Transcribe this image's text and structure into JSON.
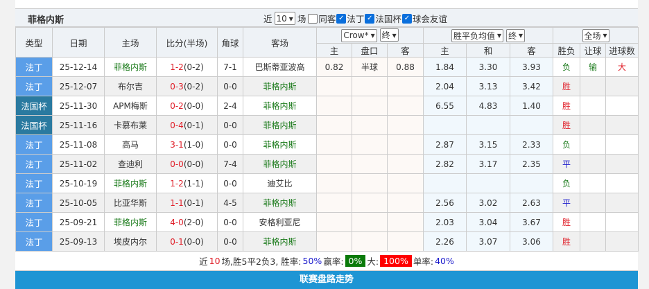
{
  "team": "菲格内斯",
  "filter": {
    "prefix": "近",
    "count": "10",
    "suffix": "场",
    "options": [
      {
        "label": "同客",
        "checked": false
      },
      {
        "label": "法丁",
        "checked": true
      },
      {
        "label": "法国杯",
        "checked": true
      },
      {
        "label": "球会友谊",
        "checked": true
      }
    ]
  },
  "headers": {
    "type": "类型",
    "date": "日期",
    "home": "主场",
    "score": "比分(半场)",
    "corner": "角球",
    "away": "客场",
    "company": "Crow*",
    "stage1": "终",
    "avg": "胜平负均值",
    "stage2": "终",
    "scope": "全场",
    "h_home": "主",
    "h_line": "盘口",
    "h_away": "客",
    "e_home": "主",
    "e_draw": "和",
    "e_away": "客",
    "res": "胜负",
    "ah": "让球",
    "ou": "进球数"
  },
  "rows": [
    {
      "type": "法丁",
      "cup": false,
      "date": "25-12-14",
      "home": "菲格内斯",
      "home_team": true,
      "ft": "1-2",
      "ht": "(0-2)",
      "corner": "7-1",
      "away": "巴斯蒂亚波高",
      "away_team": false,
      "ah_h": "0.82",
      "ah_l": "半球",
      "ah_a": "0.88",
      "e_h": "1.84",
      "e_d": "3.30",
      "e_a": "3.93",
      "res": "负",
      "ah": "输",
      "ou": "大"
    },
    {
      "type": "法丁",
      "cup": false,
      "date": "25-12-07",
      "home": "布尔吉",
      "home_team": false,
      "ft": "0-3",
      "ht": "(0-2)",
      "corner": "0-0",
      "away": "菲格内斯",
      "away_team": true,
      "e_h": "2.04",
      "e_d": "3.13",
      "e_a": "3.42",
      "res": "胜"
    },
    {
      "type": "法国杯",
      "cup": true,
      "date": "25-11-30",
      "home": "APM梅斯",
      "home_team": false,
      "ft": "0-2",
      "ht": "(0-0)",
      "corner": "2-4",
      "away": "菲格内斯",
      "away_team": true,
      "e_h": "6.55",
      "e_d": "4.83",
      "e_a": "1.40",
      "res": "胜"
    },
    {
      "type": "法国杯",
      "cup": true,
      "date": "25-11-16",
      "home": "卡慕布莱",
      "home_team": false,
      "ft": "0-4",
      "ht": "(0-1)",
      "corner": "0-0",
      "away": "菲格内斯",
      "away_team": true,
      "res": "胜"
    },
    {
      "type": "法丁",
      "cup": false,
      "date": "25-11-08",
      "home": "高马",
      "home_team": false,
      "ft": "3-1",
      "ht": "(1-0)",
      "corner": "0-0",
      "away": "菲格内斯",
      "away_team": true,
      "e_h": "2.87",
      "e_d": "3.15",
      "e_a": "2.33",
      "res": "负"
    },
    {
      "type": "法丁",
      "cup": false,
      "date": "25-11-02",
      "home": "查迪利",
      "home_team": false,
      "ft": "0-0",
      "ht": "(0-0)",
      "corner": "7-4",
      "away": "菲格内斯",
      "away_team": true,
      "e_h": "2.82",
      "e_d": "3.17",
      "e_a": "2.35",
      "res": "平"
    },
    {
      "type": "法丁",
      "cup": false,
      "date": "25-10-19",
      "home": "菲格内斯",
      "home_team": true,
      "ft": "1-2",
      "ht": "(1-1)",
      "corner": "0-0",
      "away": "迪艾比",
      "away_team": false,
      "res": "负"
    },
    {
      "type": "法丁",
      "cup": false,
      "date": "25-10-05",
      "home": "比亚华斯",
      "home_team": false,
      "ft": "1-1",
      "ht": "(0-1)",
      "corner": "4-5",
      "away": "菲格内斯",
      "away_team": true,
      "e_h": "2.56",
      "e_d": "3.02",
      "e_a": "2.63",
      "res": "平"
    },
    {
      "type": "法丁",
      "cup": false,
      "date": "25-09-21",
      "home": "菲格内斯",
      "home_team": true,
      "ft": "4-0",
      "ht": "(2-0)",
      "corner": "0-0",
      "away": "安格利亚尼",
      "away_team": false,
      "e_h": "2.03",
      "e_d": "3.04",
      "e_a": "3.67",
      "res": "胜"
    },
    {
      "type": "法丁",
      "cup": false,
      "date": "25-09-13",
      "home": "埃皮内尔",
      "home_team": false,
      "ft": "0-1",
      "ht": "(0-0)",
      "corner": "0-0",
      "away": "菲格内斯",
      "away_team": true,
      "e_h": "2.26",
      "e_d": "3.07",
      "e_a": "3.06",
      "res": "胜"
    }
  ],
  "summary": {
    "a": "近",
    "n": "10",
    "b": "场,胜5平2负3, 胜率:",
    "win": "50%",
    "c": " 赢率:",
    "ahwin": "0%",
    "d": " 大:",
    "big": "100%",
    "e": " 单率:",
    "odd": "40%"
  },
  "trend_bar": "联赛盘路走势",
  "colors": {
    "win": "#e0202a",
    "lose": "#1a7a1a",
    "draw": "#1a1acc",
    "league": "#5a9ee8",
    "cup": "#2a7aa0",
    "bar": "#1e95d4"
  }
}
